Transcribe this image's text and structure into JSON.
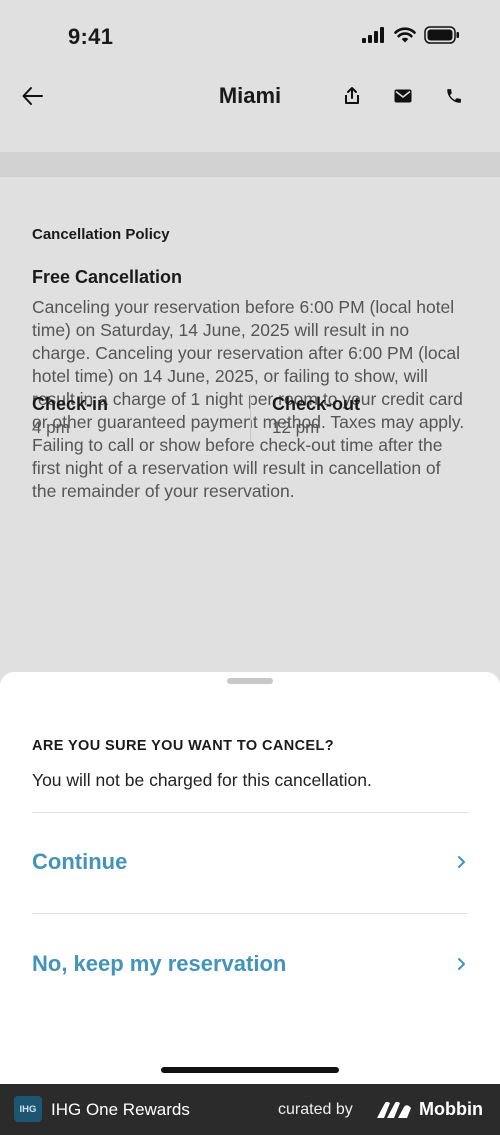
{
  "status_bar": {
    "time": "9:41"
  },
  "nav": {
    "title": "Miami"
  },
  "policy": {
    "section_label": "Cancellation Policy",
    "title": "Free Cancellation",
    "body": "Canceling your reservation before 6:00 PM (local hotel time) on Saturday, 14 June, 2025 will result in no charge. Canceling your reservation after 6:00 PM (local hotel time) on 14 June, 2025, or failing to show, will result in a charge of 1 night per room to your credit card or other guaranteed payment method. Taxes may apply. Failing to call or show before check-out time after the first night of a reservation will result in cancellation of the remainder of your reservation."
  },
  "times": {
    "checkin_label": "Check-in",
    "checkin_value": "4 pm",
    "checkout_label": "Check-out",
    "checkout_value": "12 pm"
  },
  "sheet": {
    "heading": "ARE YOU SURE YOU WANT TO CANCEL?",
    "subtext": "You will not be charged for this cancellation.",
    "continue_label": "Continue",
    "keep_label": "No, keep my reservation",
    "accent_color": "#4394b8"
  },
  "banner": {
    "app_badge": "IHG",
    "app_name": "IHG One Rewards",
    "curated_by": "curated by",
    "brand": "Mobbin"
  }
}
